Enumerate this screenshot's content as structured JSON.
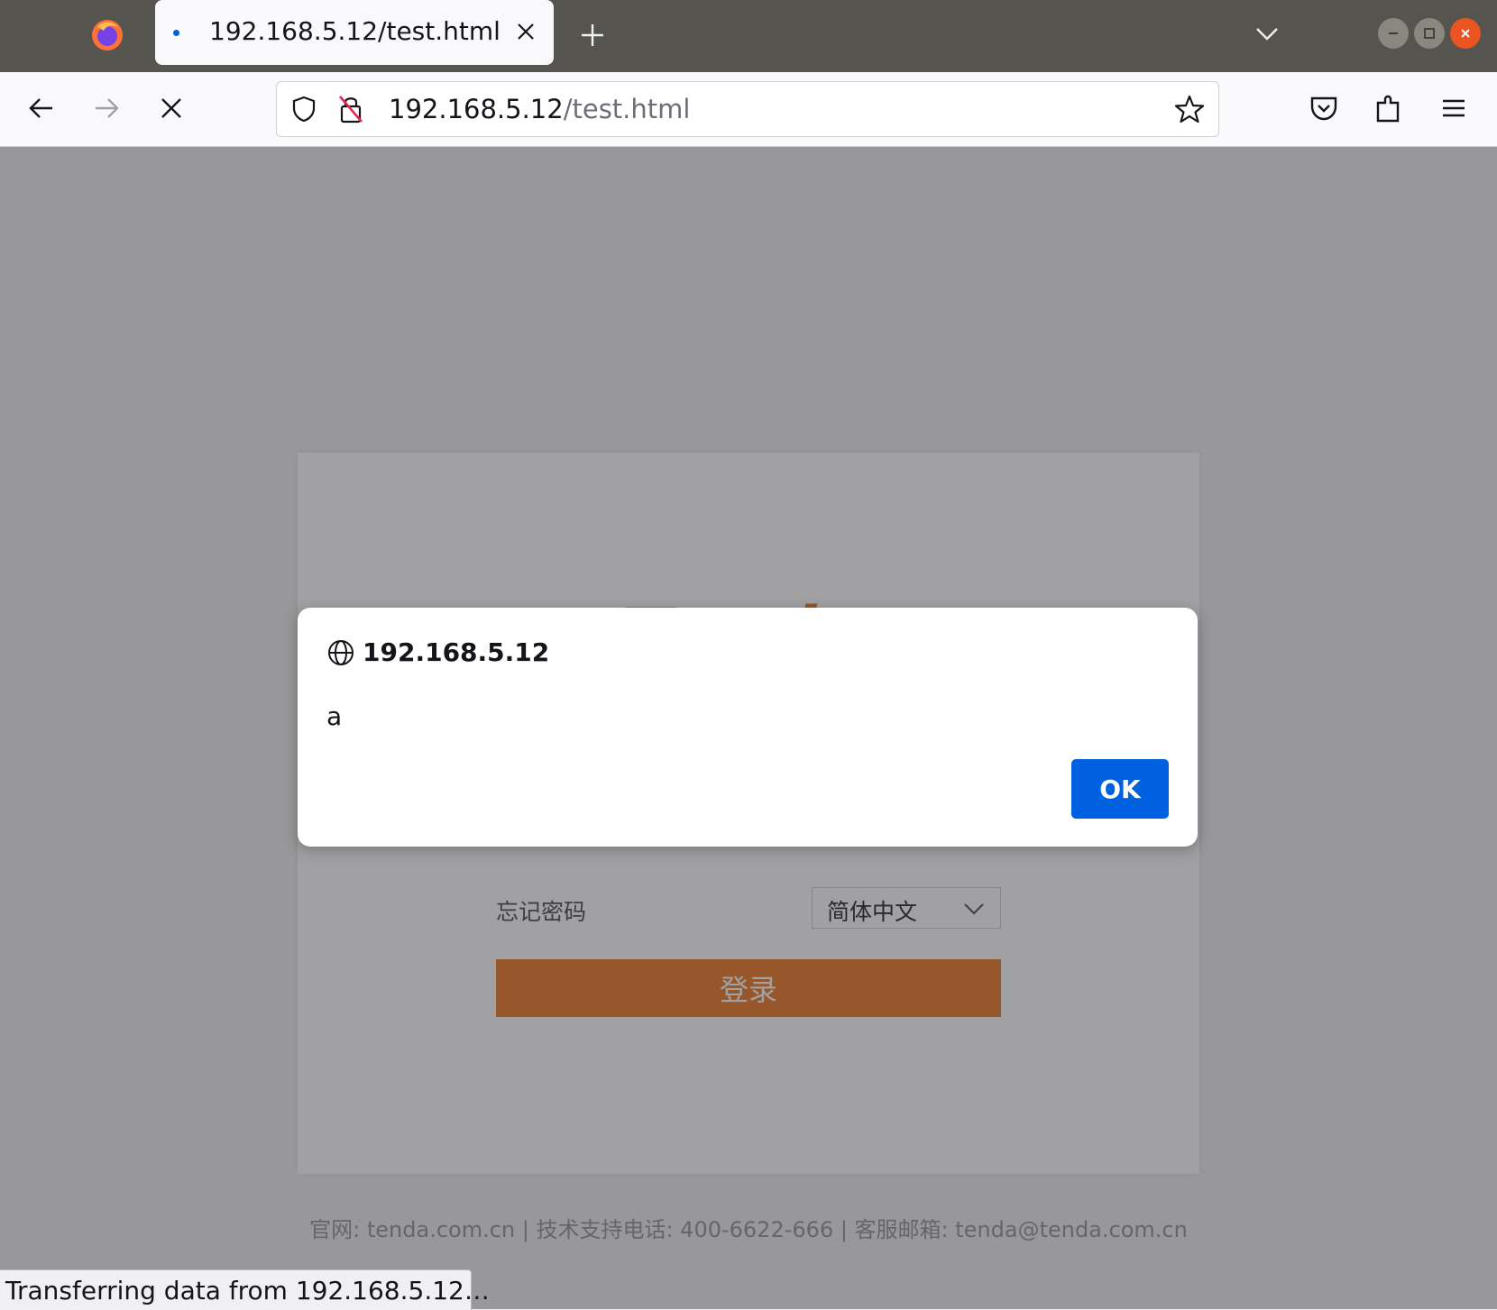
{
  "browser": {
    "tab_title": "192.168.5.12/test.html",
    "url_host": "192.168.5.12",
    "url_path": "/test.html",
    "status_text": "Transferring data from 192.168.5.12…"
  },
  "page": {
    "brand": "Tenda",
    "forgot_password": "忘记密码",
    "language": "简体中文",
    "login_button": "登录",
    "footer": "官网: tenda.com.cn | 技术支持电话: 400-6622-666 | 客服邮箱: tenda@tenda.com.cn"
  },
  "dialog": {
    "origin": "192.168.5.12",
    "message": "a",
    "ok_label": "OK"
  },
  "colors": {
    "accent_blue": "#0061e0",
    "brand_orange": "#f08030",
    "close_orange": "#e95420"
  },
  "icons": {
    "firefox": "firefox-logo-icon",
    "tab_close": "close-icon",
    "new_tab": "plus-icon",
    "tab_list": "chevron-down-icon",
    "back": "arrow-left-icon",
    "forward": "arrow-right-icon",
    "stop": "stop-icon",
    "tracking": "shield-icon",
    "insecure": "insecure-lock-icon",
    "bookmark": "star-icon",
    "pocket": "pocket-icon",
    "extensions": "puzzle-icon",
    "menu": "hamburger-menu-icon",
    "globe": "globe-icon"
  }
}
